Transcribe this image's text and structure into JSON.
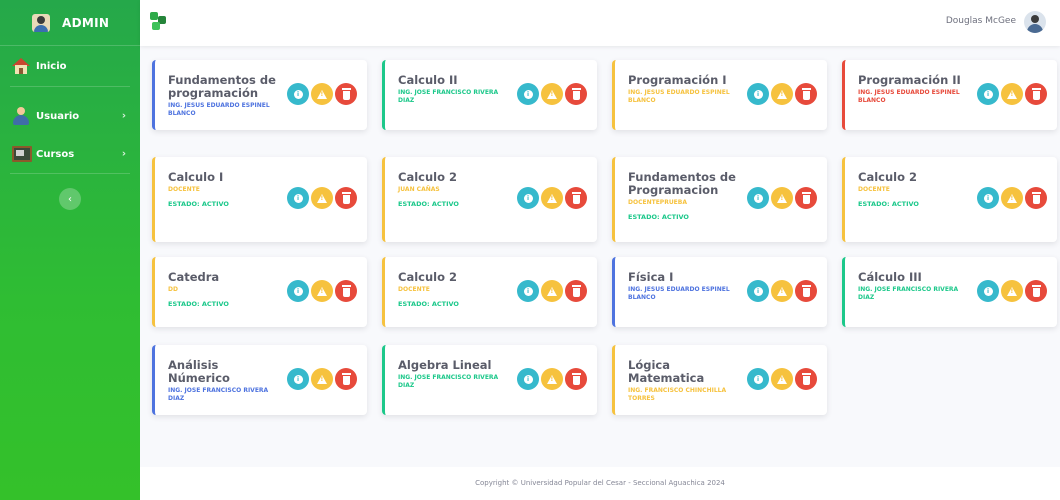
{
  "sidebar": {
    "brand": "ADMIN",
    "items": [
      {
        "label": "Inicio",
        "icon": "home-icon"
      },
      {
        "label": "Usuario",
        "icon": "user-icon",
        "chevron": "›"
      },
      {
        "label": "Cursos",
        "icon": "classroom-icon",
        "chevron": "›"
      }
    ],
    "collapse": "‹"
  },
  "topbar": {
    "user_name": "Douglas McGee"
  },
  "courses": [
    {
      "title": "Fundamentos de programación",
      "teacher": "ING. JESUS EDUARDO ESPINEL BLANCO",
      "estado": "",
      "color": "#4e73df"
    },
    {
      "title": "Calculo II",
      "teacher": "ING. JOSE FRANCISCO RIVERA DIAZ",
      "estado": "",
      "color": "#1cc88a"
    },
    {
      "title": "Programación I",
      "teacher": "ING. JESUS EDUARDO ESPINEL BLANCO",
      "estado": "",
      "color": "#f6c23e"
    },
    {
      "title": "Programación II",
      "teacher": "ING. JESUS EDUARDO ESPINEL BLANCO",
      "estado": "",
      "color": "#e74a3b"
    },
    {
      "title": "Calculo I",
      "teacher": "DOCENTE",
      "estado": "ESTADO: ACTIVO",
      "color": "#f6c23e"
    },
    {
      "title": "Calculo 2",
      "teacher": "JUAN CAÑAS",
      "estado": "ESTADO: ACTIVO",
      "color": "#f6c23e"
    },
    {
      "title": "Fundamentos de Programacion",
      "teacher": "DOCENTEPRUEBA",
      "estado": "ESTADO: ACTIVO",
      "color": "#f6c23e"
    },
    {
      "title": "Calculo 2",
      "teacher": "DOCENTE",
      "estado": "ESTADO: ACTIVO",
      "color": "#f6c23e"
    },
    {
      "title": "Catedra",
      "teacher": "DD",
      "estado": "ESTADO: ACTIVO",
      "color": "#f6c23e"
    },
    {
      "title": "Calculo 2",
      "teacher": "DOCENTE",
      "estado": "ESTADO: ACTIVO",
      "color": "#f6c23e"
    },
    {
      "title": "Física I",
      "teacher": "ING. JESUS EDUARDO ESPINEL BLANCO",
      "estado": "",
      "color": "#4e73df"
    },
    {
      "title": "Cálculo III",
      "teacher": "ING. JOSE FRANCISCO RIVERA DIAZ",
      "estado": "",
      "color": "#1cc88a"
    },
    {
      "title": "Análisis Númerico",
      "teacher": "ING. JOSE FRANCISCO RIVERA DIAZ",
      "estado": "",
      "color": "#4e73df"
    },
    {
      "title": "Algebra Lineal",
      "teacher": "ING. JOSE FRANCISCO RIVERA DIAZ",
      "estado": "",
      "color": "#1cc88a"
    },
    {
      "title": "Lógica Matematica",
      "teacher": "ING. FRANCISCO CHINCHILLA TORRES",
      "estado": "",
      "color": "#f6c23e"
    }
  ],
  "buttons": {
    "info": "i",
    "colors": {
      "info": "#36b9cc",
      "warn": "#f6c23e",
      "delete": "#e74a3b"
    }
  },
  "footer": "Copyright © Universidad Popular del Cesar - Seccional Aguachica 2024"
}
